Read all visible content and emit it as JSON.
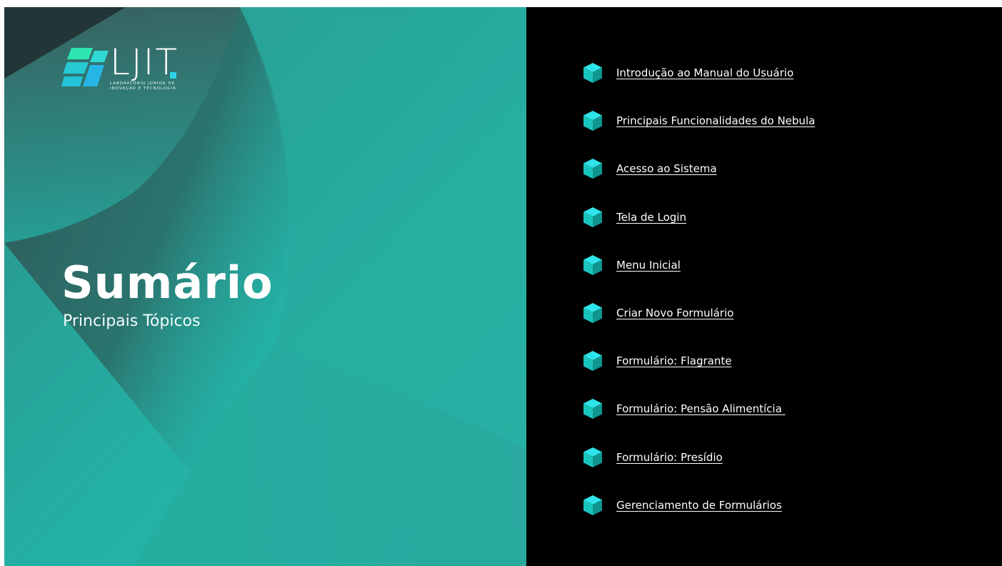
{
  "logo": {
    "wordmark": "LJIT",
    "tagline_line1": "Laboratório Júnior de",
    "tagline_line2": "Inovação e Tecnologia"
  },
  "title": "Sumário",
  "subtitle": "Principais Tópicos",
  "toc": [
    {
      "label": "Introdução ao Manual do Usuário",
      "icon": "cube-icon"
    },
    {
      "label": "Principais Funcionalidades do Nebula",
      "icon": "cube-icon"
    },
    {
      "label": "Acesso ao Sistema",
      "icon": "cube-icon"
    },
    {
      "label": "Tela de Login",
      "icon": "cube-icon"
    },
    {
      "label": "Menu Inicial",
      "icon": "cube-icon"
    },
    {
      "label": "Criar Novo Formulário",
      "icon": "cube-icon"
    },
    {
      "label": "Formulário: Flagrante",
      "icon": "cube-icon"
    },
    {
      "label": "Formulário: Pensão Alimentícia ",
      "icon": "cube-icon"
    },
    {
      "label": "Formulário: Presídio",
      "icon": "cube-icon"
    },
    {
      "label": "Gerenciamento de Formulários",
      "icon": "cube-icon"
    }
  ],
  "colors": {
    "teal": "#23b3a6",
    "teal_dark": "#1d6f6a",
    "slate": "#2f5657",
    "cube_light": "#29e0e6",
    "cube_mid": "#14b8b0",
    "cube_dark": "#0f8f87",
    "background_right": "#000000"
  }
}
